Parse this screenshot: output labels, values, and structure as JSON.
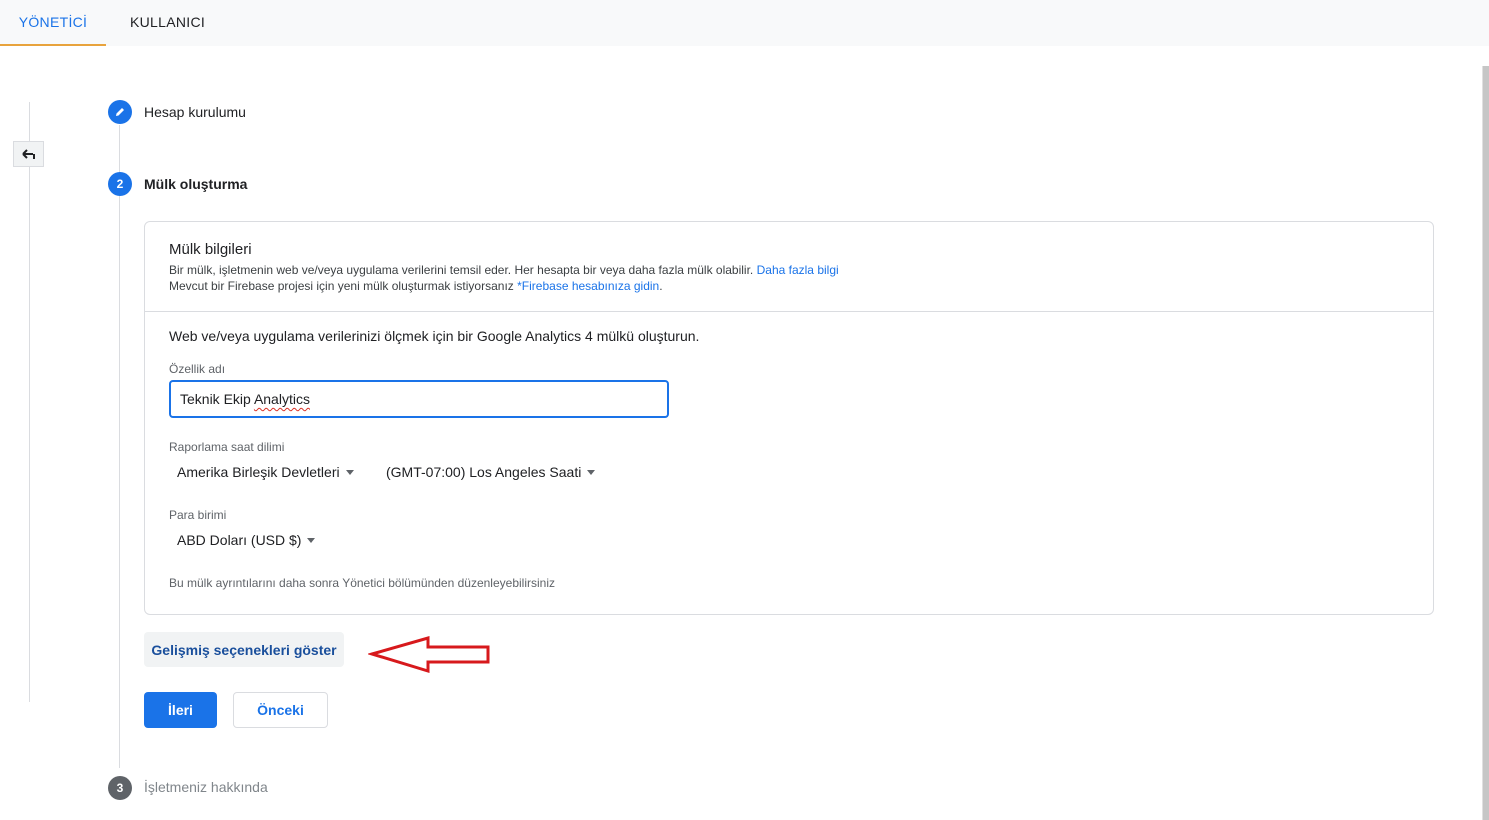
{
  "tabs": {
    "admin": "YÖNETİCİ",
    "user": "KULLANICI"
  },
  "steps": {
    "step1": {
      "label": "Hesap kurulumu",
      "icon": "pencil-icon"
    },
    "step2": {
      "number": "2",
      "label": "Mülk oluşturma"
    },
    "step3": {
      "number": "3",
      "label": "İşletmeniz hakkında"
    }
  },
  "card": {
    "title": "Mülk bilgileri",
    "desc1": "Bir mülk, işletmenin web ve/veya uygulama verilerini temsil eder. Her hesapta bir veya daha fazla mülk olabilir.",
    "desc1_link": "Daha fazla bilgi",
    "desc2": "Mevcut bir Firebase projesi için yeni mülk oluşturmak istiyorsanız",
    "desc2_link": "*Firebase hesabınıza gidin",
    "desc2_end": ".",
    "intro": "Web ve/veya uygulama verilerinizi ölçmek için bir Google Analytics 4 mülkü oluşturun.",
    "property_name_label": "Özellik adı",
    "property_name_value_part1": "Teknik Ekip ",
    "property_name_value_part2": "Analytics",
    "timezone_label": "Raporlama saat dilimi",
    "country_value": "Amerika Birleşik Devletleri",
    "timezone_value": "(GMT-07:00) Los Angeles Saati",
    "currency_label": "Para birimi",
    "currency_value": "ABD Doları (USD $)",
    "footnote": "Bu mülk ayrıntılarını daha sonra Yönetici bölümünden düzenleyebilirsiniz"
  },
  "buttons": {
    "advanced": "Gelişmiş seçenekleri göster",
    "next": "İleri",
    "previous": "Önceki"
  },
  "colors": {
    "accent": "#1a73e8",
    "annotation_arrow": "#d7191c",
    "inactive_step": "#5f6368"
  }
}
